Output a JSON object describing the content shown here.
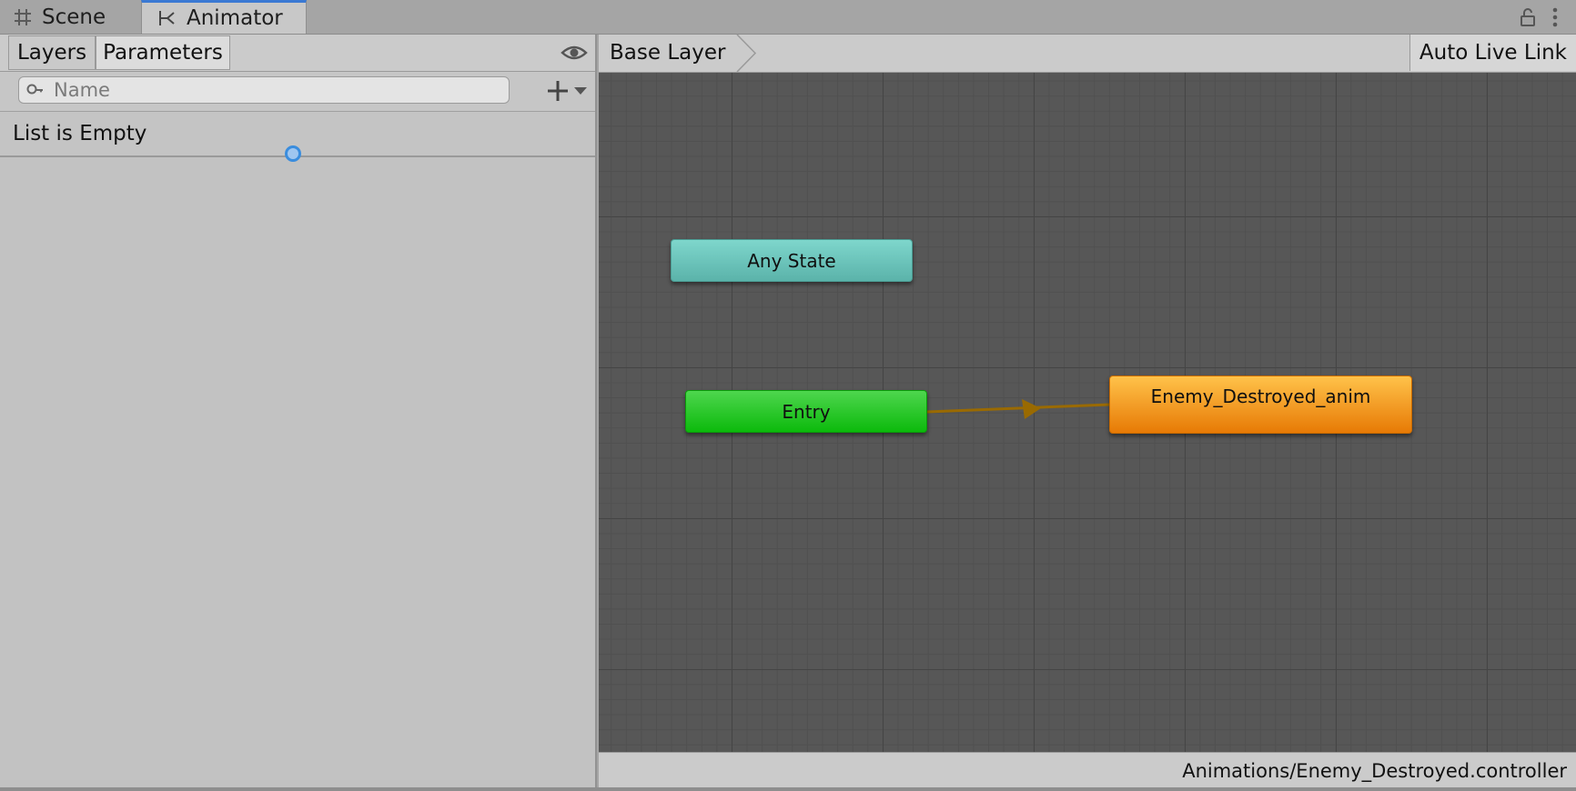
{
  "window_tabs": [
    {
      "label": "Scene",
      "icon": "grid-icon",
      "active": false
    },
    {
      "label": "Animator",
      "icon": "animator-icon",
      "active": true
    }
  ],
  "left_panel": {
    "tabs": [
      {
        "label": "Layers",
        "active": false
      },
      {
        "label": "Parameters",
        "active": true
      }
    ],
    "search": {
      "placeholder": "Name",
      "value": ""
    },
    "empty_message": "List is Empty"
  },
  "graph_panel": {
    "breadcrumb": "Base Layer",
    "live_link_label": "Auto Live Link",
    "nodes": {
      "any_state": "Any State",
      "entry": "Entry",
      "default_state": "Enemy_Destroyed_anim"
    },
    "status_path": "Animations/Enemy_Destroyed.controller"
  },
  "colors": {
    "accent_tab": "#3a79d3",
    "any_state": "#6cc5bb",
    "entry": "#1cc41c",
    "default_state": "#f59a1c",
    "transition": "#9a6a00",
    "graph_bg": "#575757"
  }
}
